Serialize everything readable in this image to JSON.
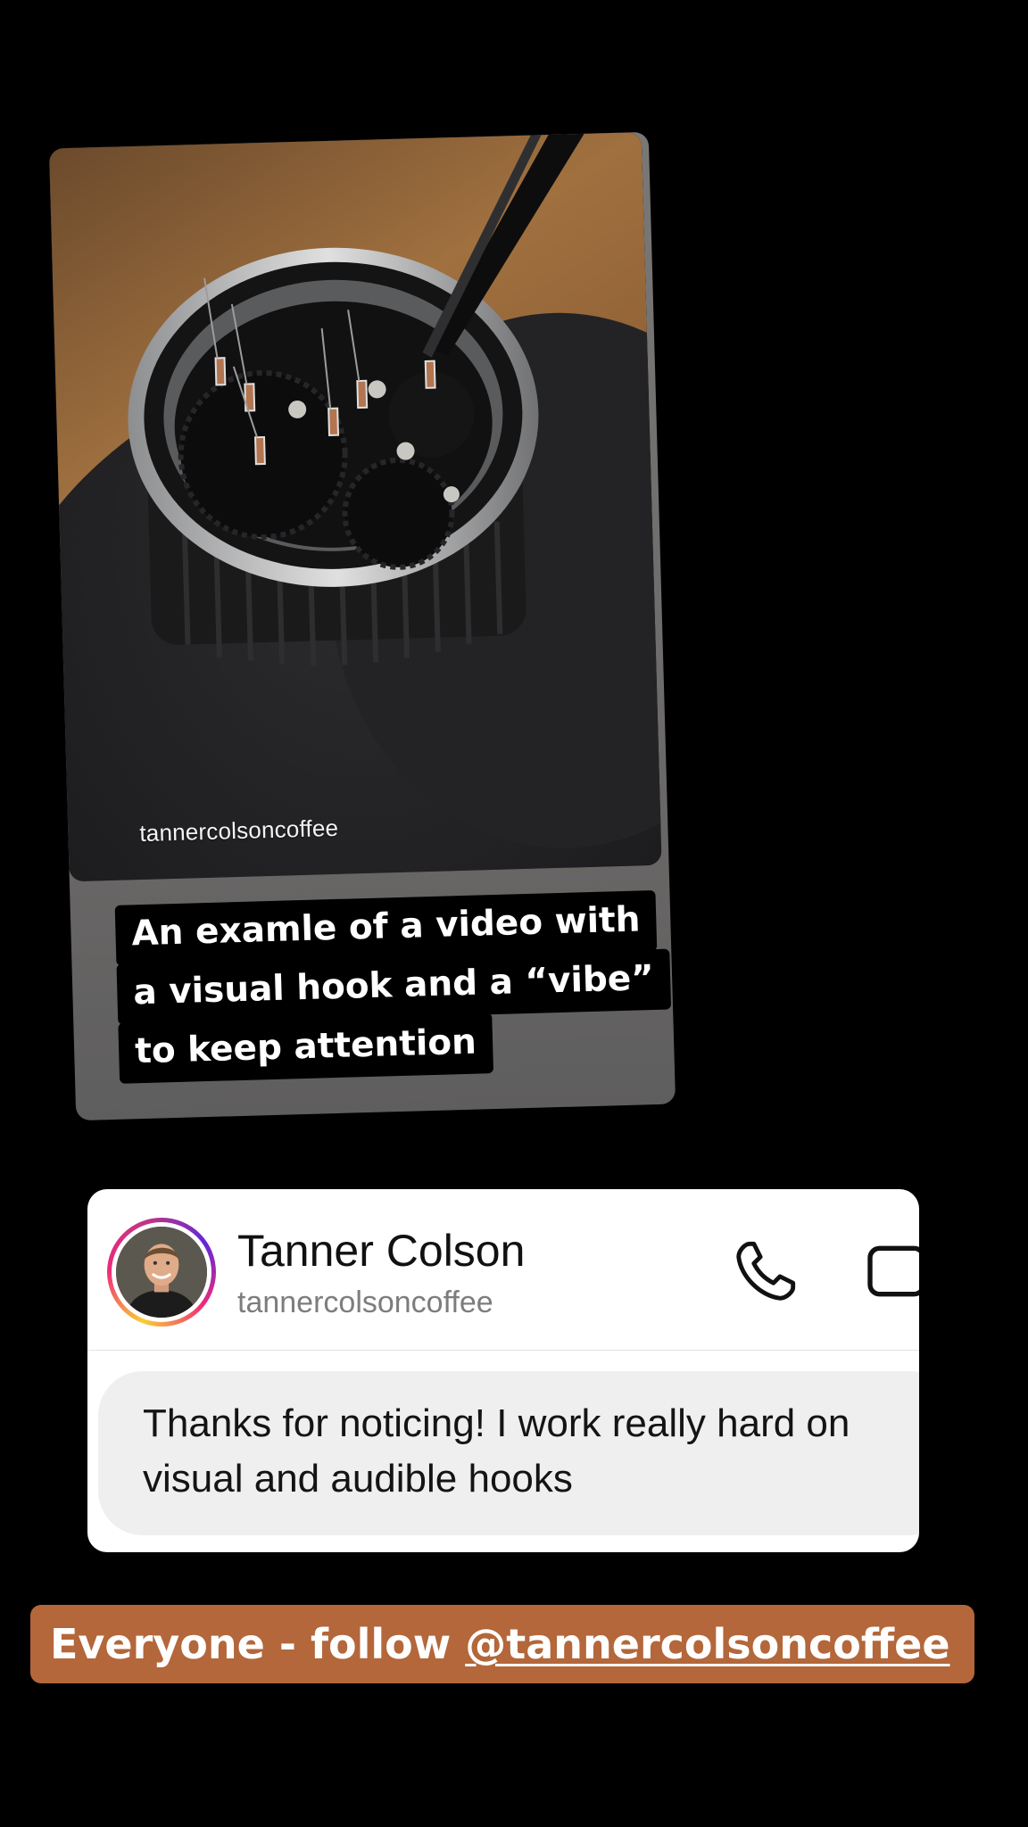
{
  "repost": {
    "video_username": "tannercolsoncoffee",
    "caption_lines": [
      "An examle of a video with",
      "a visual hook and a “vibe”",
      "to keep attention"
    ]
  },
  "dm": {
    "name": "Tanner Colson",
    "handle": "tannercolsoncoffee",
    "message": "Thanks for noticing! I work really hard on visual and audible hooks",
    "icons": [
      "phone-icon",
      "video-call-icon"
    ]
  },
  "banner": {
    "prefix": "Everyone - follow ",
    "mention": "@tannercolsoncoffee",
    "color": "#b3673a"
  },
  "colors": {
    "background": "#000000",
    "dm_bubble": "#efefef",
    "handle_gray": "#7d7d7d"
  }
}
